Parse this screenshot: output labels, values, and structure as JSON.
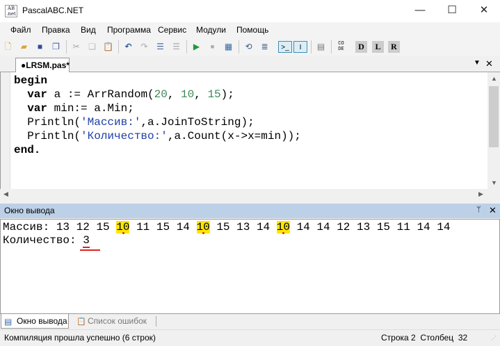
{
  "window": {
    "title": "PascalABC.NET",
    "minimize": "—",
    "maximize": "☐",
    "close": "✕"
  },
  "menu": [
    "Файл",
    "Правка",
    "Вид",
    "Программа",
    "Сервис",
    "Модули",
    "Помощь"
  ],
  "toolbar": {
    "icons": [
      "new-file-icon",
      "open-folder-icon",
      "save-icon",
      "save-all-icon",
      "cut-icon",
      "copy-icon",
      "paste-icon",
      "undo-icon",
      "redo-icon",
      "indent-icon",
      "unindent-icon",
      "run-icon",
      "stop-icon",
      "debug-icon",
      "comment-icon",
      "step-icon",
      "console-toggle-icon",
      "output-toggle-icon",
      "list-icon",
      "code-icon",
      "doc-d-icon",
      "doc-l-icon",
      "doc-r-icon"
    ],
    "code_label": "CO DE",
    "d": "D",
    "l": "L",
    "r": "R"
  },
  "editor_tab": {
    "label": "●LRSM.pas*"
  },
  "code": [
    [
      {
        "t": "begin",
        "c": "kw"
      }
    ],
    [
      {
        "t": "  "
      },
      {
        "t": "var",
        "c": "kw"
      },
      {
        "t": " a := ArrRandom("
      },
      {
        "t": "20",
        "c": "num"
      },
      {
        "t": ", "
      },
      {
        "t": "10",
        "c": "num"
      },
      {
        "t": ", "
      },
      {
        "t": "15",
        "c": "num"
      },
      {
        "t": ");"
      }
    ],
    [
      {
        "t": "  "
      },
      {
        "t": "var",
        "c": "kw"
      },
      {
        "t": " min:= a.Min;"
      }
    ],
    [
      {
        "t": "  Println("
      },
      {
        "t": "'Массив:'",
        "c": "str"
      },
      {
        "t": ",a.JoinToString);"
      }
    ],
    [
      {
        "t": "  Println("
      },
      {
        "t": "'Количество:'",
        "c": "str"
      },
      {
        "t": ",a.Count(x->x=min));"
      }
    ],
    [
      {
        "t": "end.",
        "c": "kw"
      }
    ]
  ],
  "output_panel": {
    "title": "Окно вывода",
    "pin": "📌",
    "close": "✕"
  },
  "output": {
    "label1": "Массив:",
    "values": [
      13,
      12,
      15,
      10,
      11,
      15,
      14,
      10,
      15,
      13,
      14,
      10,
      14,
      14,
      12,
      13,
      15,
      11,
      14,
      14
    ],
    "min": 10,
    "label2": "Количество:",
    "count": "3"
  },
  "bottom_tabs": [
    "Окно вывода",
    "Список ошибок"
  ],
  "status": {
    "message": "Компиляция прошла успешно (6 строк)",
    "line_label": "Строка",
    "line": "2",
    "col_label": "Столбец",
    "col": "32"
  },
  "colors": {
    "highlight": "#ffe600",
    "mark": "#e02020",
    "header": "#bcd1e8"
  }
}
